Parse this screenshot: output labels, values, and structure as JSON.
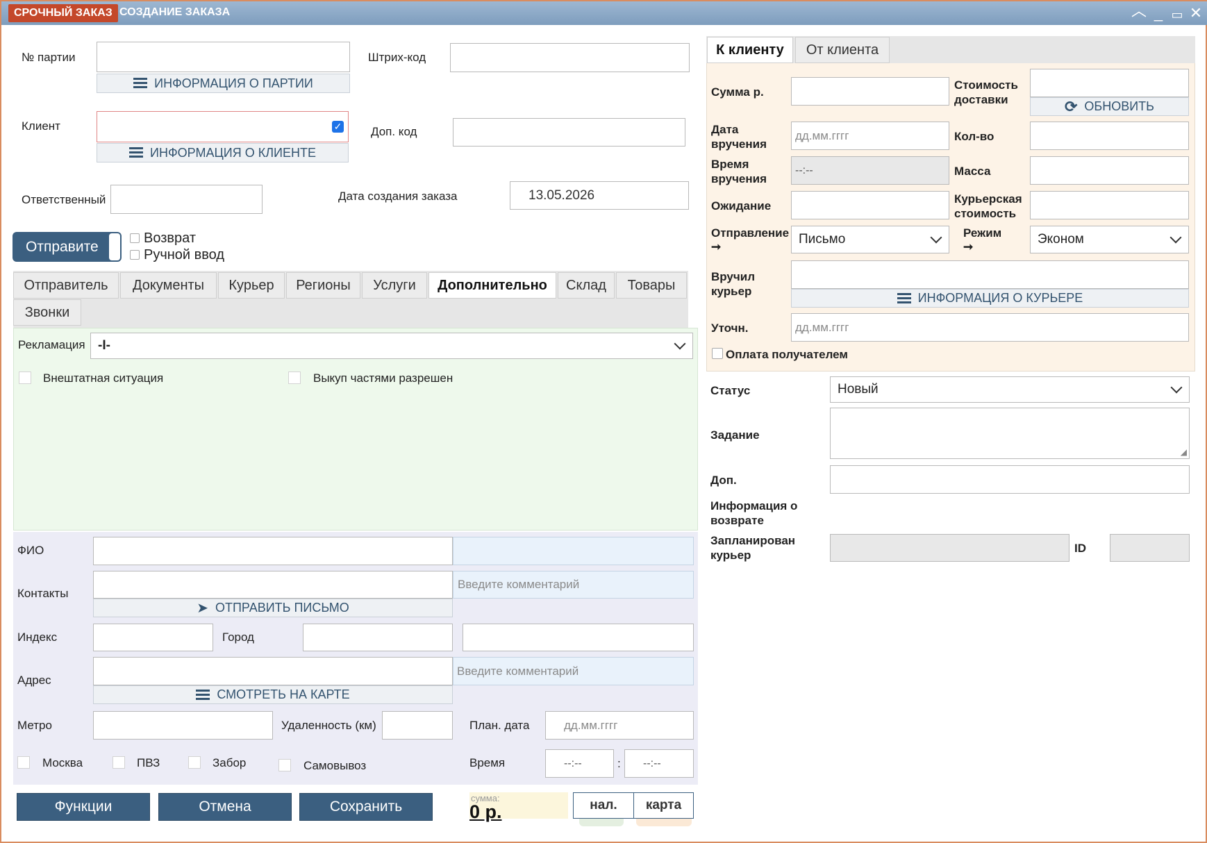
{
  "window": {
    "badge": "СРОЧНЫЙ ЗАКАЗ",
    "title": "СОЗДАНИЕ ЗАКАЗА"
  },
  "left": {
    "batch_label": "№ партии",
    "batch_info_button": "ИНФОРМАЦИЯ О ПАРТИИ",
    "barcode_label": "Штрих-код",
    "client_label": "Клиент",
    "client_info_button": "ИНФОРМАЦИЯ О КЛИЕНТЕ",
    "extra_code_label": "Доп. код",
    "responsible_label": "Ответственный",
    "created_date_label": "Дата создания заказа",
    "created_date_value": "13.05.2026",
    "sender_toggle": "Отправите",
    "return_label": "Возврат",
    "manual_label": "Ручной ввод"
  },
  "tabs": [
    "Отправитель",
    "Документы",
    "Курьер",
    "Регионы",
    "Услуги",
    "Дополнительно",
    "Склад",
    "Товары",
    "Звонки"
  ],
  "active_tab": "Дополнительно",
  "extra": {
    "reclamation_label": "Рекламация",
    "reclamation_value": "-I-",
    "emergency_label": "Внештатная ситуация",
    "partial_label": "Выкуп частями разрешен"
  },
  "recipient": {
    "fio_label": "ФИО",
    "contacts_label": "Контакты",
    "contacts_comment_placeholder": "Введите комментарий",
    "send_letter_button": "ОТПРАВИТЬ ПИСЬМО",
    "index_label": "Индекс",
    "city_label": "Город",
    "address_label": "Адрес",
    "address_comment_placeholder": "Введите  комментарий",
    "map_button": "СМОТРЕТЬ НА КАРТЕ",
    "metro_label": "Метро",
    "distance_label": "Удаленность (км)",
    "plan_date_label": "План. дата",
    "plan_date_placeholder": "дд.мм.гггг",
    "moscow_label": "Москва",
    "pvz_label": "ПВЗ",
    "pickup_label": "Забор",
    "self_pickup_label": "Самовывоз",
    "time_label": "Время",
    "time_from": "--:--",
    "time_sep": ":",
    "time_to": "--:--"
  },
  "footer": {
    "functions": "Функции",
    "cancel": "Отмена",
    "save": "Сохранить",
    "sum_label": "сумма:",
    "sum_value": "0 р.",
    "cash": "нал.",
    "card": "карта"
  },
  "right_tabs": [
    "К клиенту",
    "От клиента"
  ],
  "to_client": {
    "sum_label": "Сумма р.",
    "delivery_cost_label": "Стоимость доставки",
    "refresh_button": "ОБНОВИТЬ",
    "delivery_date_label": "Дата вручения",
    "delivery_date_placeholder": "дд.мм.гггг",
    "qty_label": "Кол-во",
    "delivery_time_label": "Время вручения",
    "delivery_time_value": "--:--",
    "mass_label": "Масса",
    "waiting_label": "Ожидание",
    "courier_cost_label": "Курьерская стоимость",
    "dispatch_label": "Отправление",
    "dispatch_value": "Письмо",
    "mode_label": "Режим",
    "mode_value": "Эконом",
    "arrow": "➞",
    "handed_label": "Вручил курьер",
    "courier_info_button": "ИНФОРМАЦИЯ О КУРЬЕРЕ",
    "clarify_label": "Уточн.",
    "clarify_placeholder": "дд.мм.гггг",
    "payer_label": "Оплата получателем"
  },
  "status_block": {
    "status_label": "Статус",
    "status_value": "Новый",
    "task_label": "Задание",
    "extra_label": "Доп.",
    "return_info_label": "Информация о возврате",
    "planned_courier_label": "Запланирован курьер",
    "id_label": "ID"
  },
  "colors": {
    "titlebar": "#8aa8c6",
    "badge": "#c4482a",
    "accent_button": "#3b5f80",
    "green_panel": "#eef9ec",
    "lavender_panel": "#ececf6",
    "peach_panel": "#fdf3e7"
  }
}
